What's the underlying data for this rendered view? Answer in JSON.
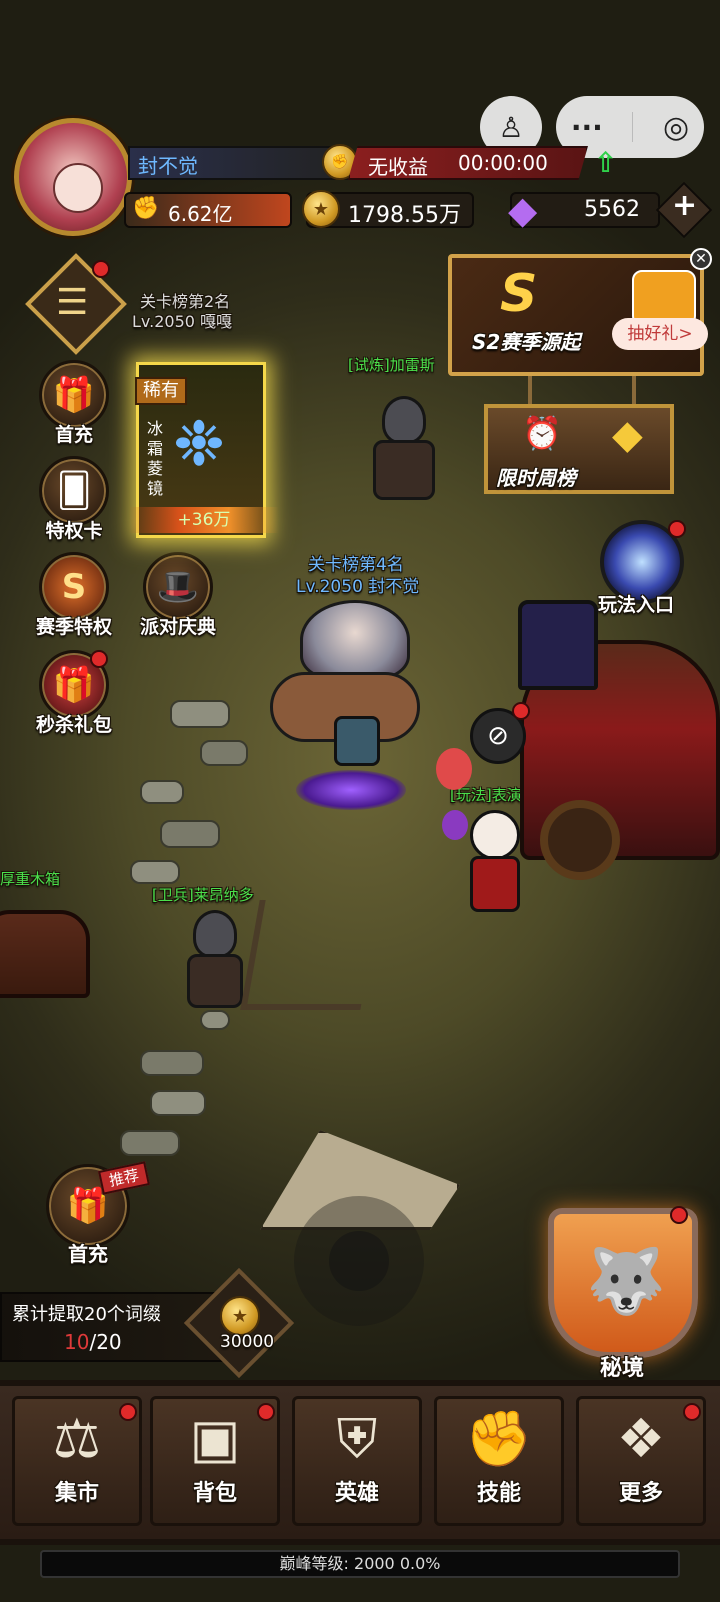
{
  "player": {
    "name": "封不觉",
    "power": "6.62亿",
    "income_label": "无收益",
    "income_timer": "00:00:00"
  },
  "resources": {
    "gold": "1798.55万",
    "diamonds": "5562"
  },
  "season_banner": {
    "title": "S2赛季源起",
    "badge": "S",
    "gift_button": "抽好礼>"
  },
  "weekly_board": {
    "label": "限时周榜"
  },
  "play_entry": {
    "label": "玩法入口"
  },
  "left_menu": [
    {
      "id": "first-recharge",
      "label": "首充"
    },
    {
      "id": "privilege-card",
      "label": "特权卡"
    },
    {
      "id": "season-privilege",
      "label": "赛季特权"
    },
    {
      "id": "party-celebration",
      "label": "派对庆典"
    },
    {
      "id": "flash-gift",
      "label": "秒杀礼包"
    }
  ],
  "rare_item": {
    "rarity": "稀有",
    "name": "冰霜菱镜",
    "bonus": "+36万"
  },
  "nameplates": {
    "rank2_title": "关卡榜第2名",
    "rank2_level": "Lv.2050 嘎嘎",
    "trial_npc": "[试炼]加雷斯",
    "rank4_title": "关卡榜第4名",
    "rank4_level": "Lv.2050 封不觉",
    "performer_npc": "[玩法]表演师",
    "guard_npc": "[卫兵]莱昂纳多",
    "chest_label": "厚重木箱"
  },
  "bottom_recharge": {
    "label": "首充",
    "tag": "推荐"
  },
  "quest": {
    "text": "累计提取20个词缀",
    "progress_current": "10",
    "progress_total": "/20",
    "reward": "30000"
  },
  "secret_realm": {
    "label": "秘境"
  },
  "nav": [
    {
      "id": "market",
      "label": "集市",
      "icon": "scale-icon"
    },
    {
      "id": "backpack",
      "label": "背包",
      "icon": "backpack-icon"
    },
    {
      "id": "hero",
      "label": "英雄",
      "icon": "helmet-icon"
    },
    {
      "id": "skill",
      "label": "技能",
      "icon": "fire-fist-icon"
    },
    {
      "id": "more",
      "label": "更多",
      "icon": "diamond-grid-icon"
    }
  ],
  "peak_level": "巅峰等级: 2000   0.0%",
  "colors": {
    "accent_red": "#e02a2a",
    "gold": "#d19a24",
    "nameplate_green": "#4be04b",
    "nameplate_blue": "#6fb9ff"
  }
}
